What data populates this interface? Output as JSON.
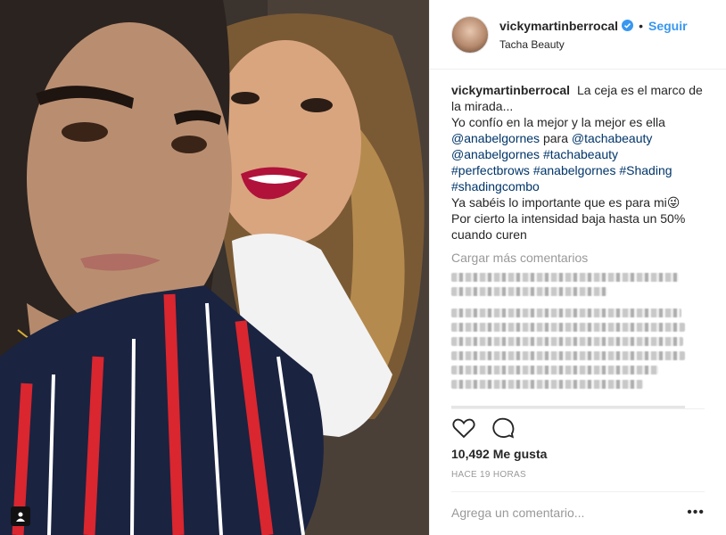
{
  "post": {
    "username": "vickymartinberrocal",
    "follow_label": "Seguir",
    "location": "Tacha Beauty",
    "caption": {
      "line1": "La ceja es el marco de la mirada...",
      "line2": "Yo confío en la mejor y la mejor es ella",
      "mention1": "@anabelgornes",
      "para": "para",
      "mention2": "@tachabeauty",
      "mention3": "@anabelgornes",
      "tag1": "#tachabeauty",
      "tag2": "#perfectbrows",
      "tag3": "#anabelgornes",
      "tag4": "#Shading",
      "tag5": "#shadingcombo",
      "line3": "Ya sabéis lo importante que es para mi😜",
      "line4": "Por cierto la intensidad baja hasta un 50% cuando curen"
    },
    "load_more_label": "Cargar más comentarios",
    "likes_label": "10,492 Me gusta",
    "time_label": "HACE 19 HORAS",
    "add_comment_placeholder": "Agrega un comentario...",
    "more_options": "•••"
  },
  "colors": {
    "link": "#003569",
    "follow": "#3897f0",
    "muted": "#999999"
  },
  "icons": [
    "verified-icon",
    "heart-icon",
    "comment-icon",
    "user-tag-icon",
    "more-options-icon"
  ]
}
